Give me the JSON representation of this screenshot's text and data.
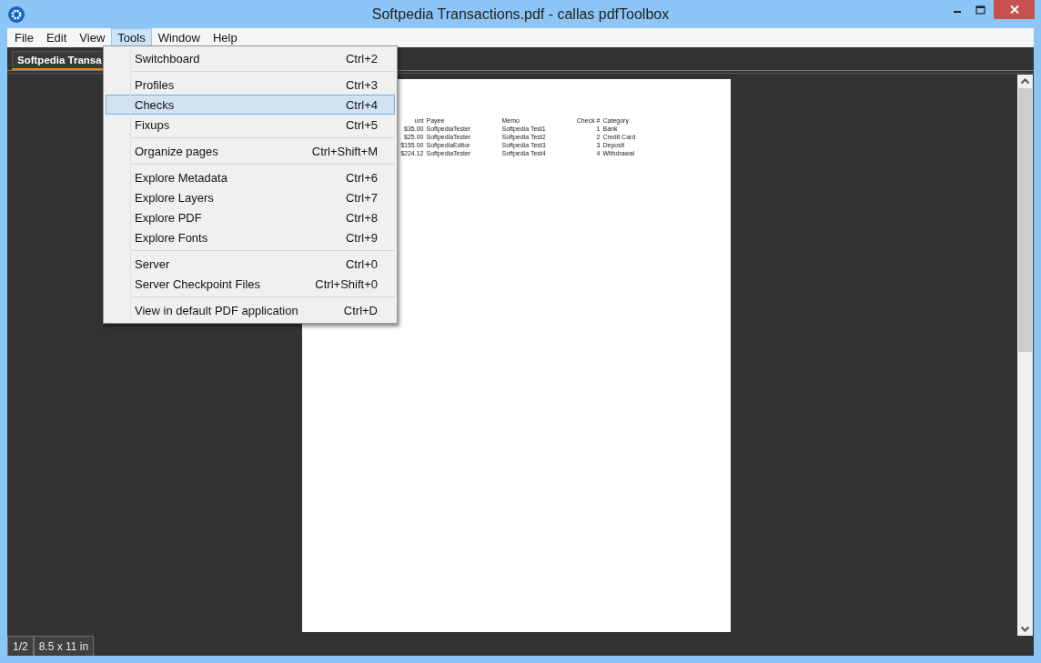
{
  "window": {
    "title": "Softpedia Transactions.pdf - callas pdfToolbox"
  },
  "menu_bar": [
    {
      "label": "File",
      "selected": false
    },
    {
      "label": "Edit",
      "selected": false
    },
    {
      "label": "View",
      "selected": false
    },
    {
      "label": "Tools",
      "selected": true
    },
    {
      "label": "Window",
      "selected": false
    },
    {
      "label": "Help",
      "selected": false
    }
  ],
  "tabs": [
    {
      "label": "Softpedia Transa",
      "selected": true
    }
  ],
  "open_menu": {
    "items": [
      {
        "kind": "item",
        "label": "Switchboard",
        "shortcut": "Ctrl+2",
        "selected": false
      },
      {
        "kind": "separator"
      },
      {
        "kind": "item",
        "label": "Profiles",
        "shortcut": "Ctrl+3",
        "selected": false
      },
      {
        "kind": "item",
        "label": "Checks",
        "shortcut": "Ctrl+4",
        "selected": true
      },
      {
        "kind": "item",
        "label": "Fixups",
        "shortcut": "Ctrl+5",
        "selected": false
      },
      {
        "kind": "separator"
      },
      {
        "kind": "item",
        "label": "Organize pages",
        "shortcut": "Ctrl+Shift+M",
        "selected": false
      },
      {
        "kind": "separator"
      },
      {
        "kind": "item",
        "label": "Explore Metadata",
        "shortcut": "Ctrl+6",
        "selected": false
      },
      {
        "kind": "item",
        "label": "Explore Layers",
        "shortcut": "Ctrl+7",
        "selected": false
      },
      {
        "kind": "item",
        "label": "Explore PDF",
        "shortcut": "Ctrl+8",
        "selected": false
      },
      {
        "kind": "item",
        "label": "Explore Fonts",
        "shortcut": "Ctrl+9",
        "selected": false
      },
      {
        "kind": "separator"
      },
      {
        "kind": "item",
        "label": "Server",
        "shortcut": "Ctrl+0",
        "selected": false
      },
      {
        "kind": "item",
        "label": "Server Checkpoint Files",
        "shortcut": "Ctrl+Shift+0",
        "selected": false
      },
      {
        "kind": "separator"
      },
      {
        "kind": "item",
        "label": "View in default PDF application",
        "shortcut": "Ctrl+D",
        "selected": false
      }
    ]
  },
  "pdf_page": {
    "table": {
      "columns": [
        "unt",
        "Payee",
        "Memo",
        "Check #",
        "Category"
      ],
      "rows": [
        [
          "$35.00",
          "SoftpediaTester",
          "Softpedia Test1",
          "1",
          "Bank"
        ],
        [
          "$25.00",
          "SoftpediaTester",
          "Softpedia Test2",
          "2",
          "Credit Card"
        ],
        [
          "$155.00",
          "SoftpediaEditor",
          "Softpedia Test3",
          "3",
          "Deposit"
        ],
        [
          "$224.12",
          "SoftpediaTester",
          "Softpedia Test4",
          "4",
          "Withdrawal"
        ]
      ]
    }
  },
  "status_bar": [
    "1/2",
    "8.5 x 11 in"
  ]
}
